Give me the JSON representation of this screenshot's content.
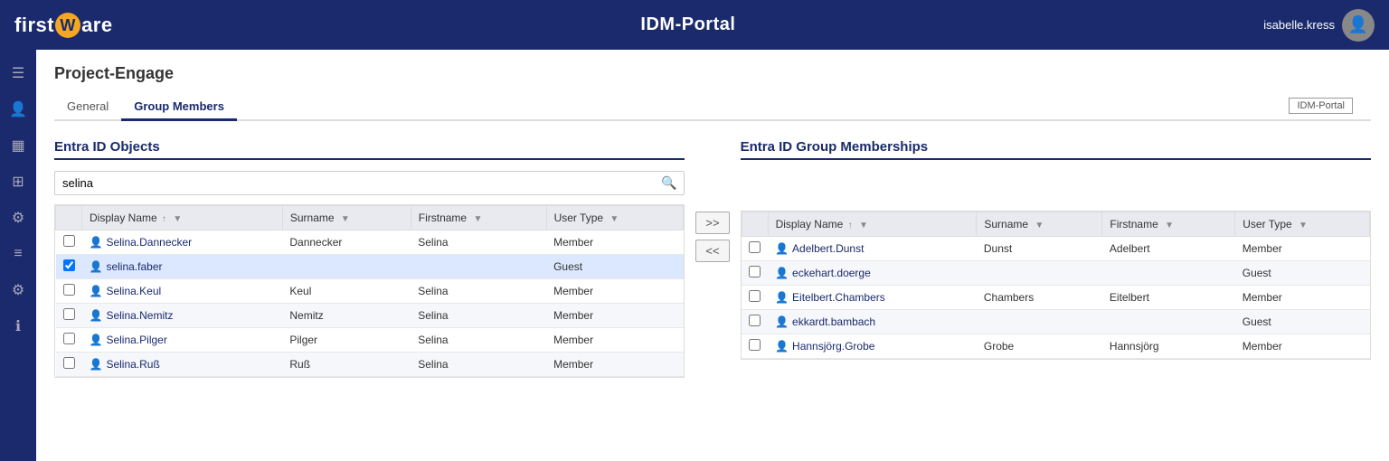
{
  "header": {
    "logo_first": "first",
    "logo_w": "W",
    "logo_are": "are",
    "title": "IDM-Portal",
    "username": "isabelle.kress"
  },
  "sidebar": {
    "icons": [
      {
        "name": "menu-icon",
        "glyph": "☰"
      },
      {
        "name": "user-icon",
        "glyph": "👤"
      },
      {
        "name": "grid-icon",
        "glyph": "▦"
      },
      {
        "name": "apps-icon",
        "glyph": "⊞"
      },
      {
        "name": "settings-cog-icon",
        "glyph": "⚙"
      },
      {
        "name": "list-icon",
        "glyph": "☰"
      },
      {
        "name": "gear-icon",
        "glyph": "⚙"
      },
      {
        "name": "info-icon",
        "glyph": "ℹ"
      }
    ]
  },
  "page": {
    "title": "Project-Engage",
    "tabs": [
      {
        "label": "General",
        "active": false
      },
      {
        "label": "Group Members",
        "active": true
      }
    ],
    "tab_badge": "IDM-Portal"
  },
  "left_panel": {
    "heading": "Entra ID Objects",
    "search_value": "selina",
    "search_placeholder": "selina",
    "columns": [
      "Display Name",
      "Surname",
      "Firstname",
      "User Type"
    ],
    "rows": [
      {
        "id": 1,
        "display_name": "Selina.Dannecker",
        "surname": "Dannecker",
        "firstname": "Selina",
        "user_type": "Member",
        "checked": false,
        "selected": false
      },
      {
        "id": 2,
        "display_name": "selina.faber",
        "surname": "",
        "firstname": "",
        "user_type": "Guest",
        "checked": true,
        "selected": true
      },
      {
        "id": 3,
        "display_name": "Selina.Keul",
        "surname": "Keul",
        "firstname": "Selina",
        "user_type": "Member",
        "checked": false,
        "selected": false
      },
      {
        "id": 4,
        "display_name": "Selina.Nemitz",
        "surname": "Nemitz",
        "firstname": "Selina",
        "user_type": "Member",
        "checked": false,
        "selected": false
      },
      {
        "id": 5,
        "display_name": "Selina.Pilger",
        "surname": "Pilger",
        "firstname": "Selina",
        "user_type": "Member",
        "checked": false,
        "selected": false
      },
      {
        "id": 6,
        "display_name": "Selina.Ruß",
        "surname": "Ruß",
        "firstname": "Selina",
        "user_type": "Member",
        "checked": false,
        "selected": false
      }
    ]
  },
  "transfer": {
    "forward_label": ">>",
    "backward_label": "<<"
  },
  "right_panel": {
    "heading": "Entra ID Group Memberships",
    "columns": [
      "Display Name",
      "Surname",
      "Firstname",
      "User Type"
    ],
    "rows": [
      {
        "id": 1,
        "display_name": "Adelbert.Dunst",
        "surname": "Dunst",
        "firstname": "Adelbert",
        "user_type": "Member",
        "checked": false,
        "selected": false
      },
      {
        "id": 2,
        "display_name": "eckehart.doerge",
        "surname": "",
        "firstname": "",
        "user_type": "Guest",
        "checked": false,
        "selected": false
      },
      {
        "id": 3,
        "display_name": "Eitelbert.Chambers",
        "surname": "Chambers",
        "firstname": "Eitelbert",
        "user_type": "Member",
        "checked": false,
        "selected": false
      },
      {
        "id": 4,
        "display_name": "ekkardt.bambach",
        "surname": "",
        "firstname": "",
        "user_type": "Guest",
        "checked": false,
        "selected": false
      },
      {
        "id": 5,
        "display_name": "Hannsjörg.Grobe",
        "surname": "Grobe",
        "firstname": "Hannsjörg",
        "user_type": "Member",
        "checked": false,
        "selected": false
      }
    ]
  }
}
